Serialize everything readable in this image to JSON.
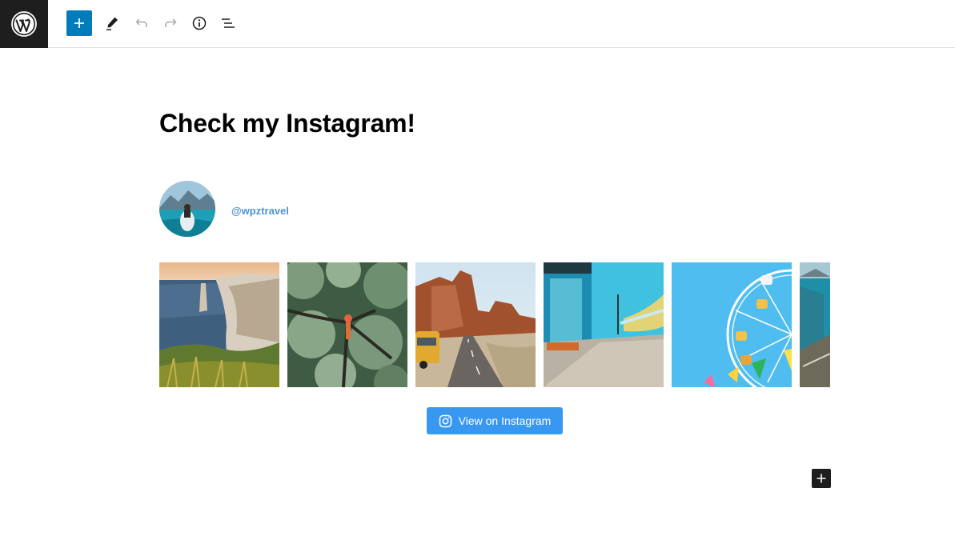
{
  "toolbar": {
    "logo_icon": "wordpress-logo-icon",
    "buttons": [
      {
        "name": "add-block-button",
        "icon": "plus-icon",
        "accent": "#007cba"
      },
      {
        "name": "tools-button",
        "icon": "pencil-icon"
      },
      {
        "name": "undo-button",
        "icon": "undo-icon"
      },
      {
        "name": "redo-button",
        "icon": "redo-icon"
      },
      {
        "name": "details-button",
        "icon": "info-icon"
      },
      {
        "name": "list-view-button",
        "icon": "list-view-icon"
      }
    ]
  },
  "content": {
    "heading": "Check my Instagram!",
    "instagram": {
      "username": "@wpztravel",
      "button_label": "View on Instagram",
      "button_color": "#3897f0",
      "photos": [
        {
          "name": "photo-coastal-cliffs"
        },
        {
          "name": "photo-forest-canopy"
        },
        {
          "name": "photo-desert-road-van"
        },
        {
          "name": "photo-bus-stop-street"
        },
        {
          "name": "photo-ferris-wheel"
        },
        {
          "name": "photo-coastline-partial"
        }
      ]
    },
    "append_block_icon": "plus-icon"
  }
}
